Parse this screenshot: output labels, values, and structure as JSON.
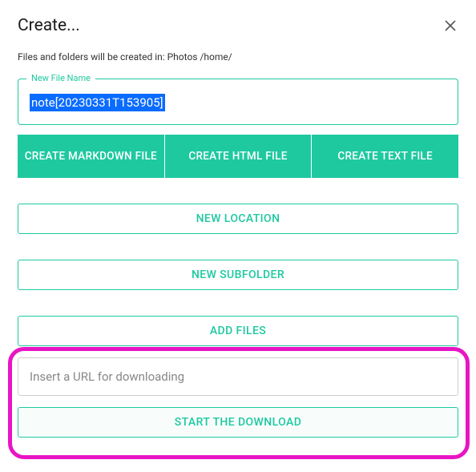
{
  "title": "Create...",
  "subtext": "Files and folders will be created in: Photos /home/",
  "newFileLegend": "New File Name",
  "filenameValue": "note[20230331T153905]",
  "buttons": {
    "createMarkdown": "CREATE MARKDOWN FILE",
    "createHtml": "CREATE HTML FILE",
    "createText": "CREATE TEXT FILE",
    "newLocation": "NEW LOCATION",
    "newSubfolder": "NEW SUBFOLDER",
    "addFiles": "ADD FILES",
    "startDownload": "START THE DOWNLOAD"
  },
  "urlPlaceholder": "Insert a URL for downloading"
}
